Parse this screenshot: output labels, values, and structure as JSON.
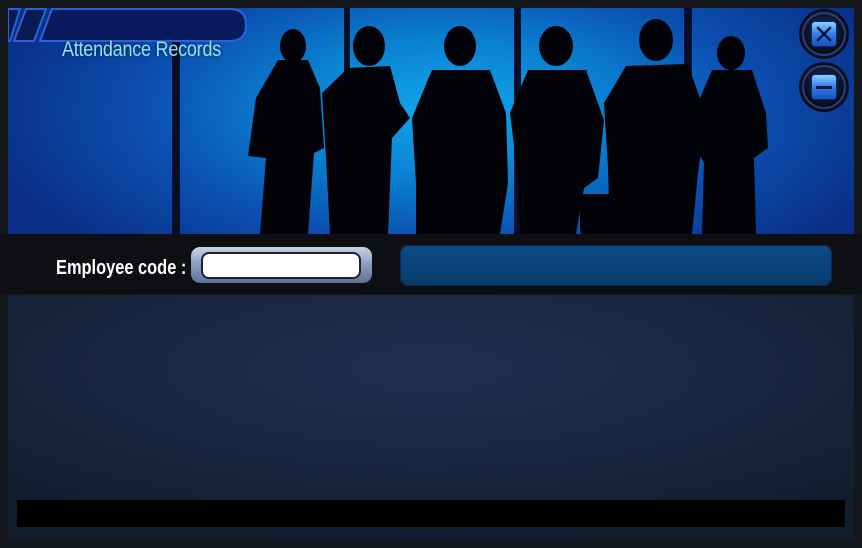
{
  "window": {
    "title": "Attendance Records"
  },
  "controls": {
    "close_icon": "close-icon",
    "minimize_icon": "minimize-icon"
  },
  "form": {
    "employee_code_label": "Employee code :",
    "employee_code_value": "",
    "employee_code_placeholder": ""
  },
  "result": {
    "text": ""
  },
  "status": {
    "text": ""
  },
  "colors": {
    "banner_accent": "#0a8fe0",
    "title_text": "#8fe3ff",
    "content_bg": "#1c2c48",
    "result_bar": "#0b4479"
  }
}
